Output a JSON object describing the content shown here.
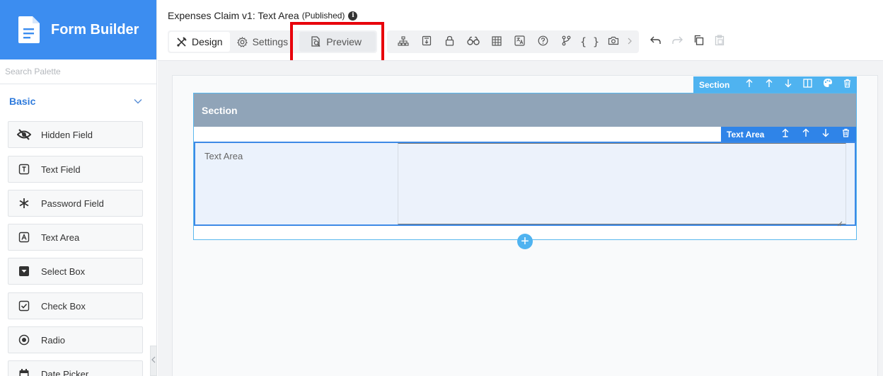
{
  "brand": {
    "title": "Form Builder"
  },
  "sidebar": {
    "search_placeholder": "Search Palette",
    "group": {
      "label": "Basic"
    },
    "items": [
      {
        "label": "Hidden Field",
        "icon": "eye-slash-icon"
      },
      {
        "label": "Text Field",
        "icon": "text-field-icon"
      },
      {
        "label": "Password Field",
        "icon": "asterisk-icon"
      },
      {
        "label": "Text Area",
        "icon": "text-area-icon"
      },
      {
        "label": "Select Box",
        "icon": "select-box-icon"
      },
      {
        "label": "Check Box",
        "icon": "check-box-icon"
      },
      {
        "label": "Radio",
        "icon": "radio-icon"
      },
      {
        "label": "Date Picker",
        "icon": "calendar-icon"
      }
    ]
  },
  "header": {
    "title": "Expenses Claim v1: Text Area",
    "status": "(Published)",
    "tabs": {
      "design": "Design",
      "settings": "Settings",
      "preview": "Preview"
    },
    "toolbar": {
      "json_label": "{ }"
    }
  },
  "canvas": {
    "section": {
      "toolbar_label": "Section",
      "title": "Section"
    },
    "field": {
      "toolbar_label": "Text Area",
      "label": "Text Area",
      "value": ""
    },
    "add_symbol": "+"
  },
  "colors": {
    "brand": "#3c8df0",
    "section_header": "#90a4b8",
    "section_toolbar": "#4fb3f0",
    "field_toolbar": "#2f84e8",
    "highlight": "#e8000b"
  }
}
